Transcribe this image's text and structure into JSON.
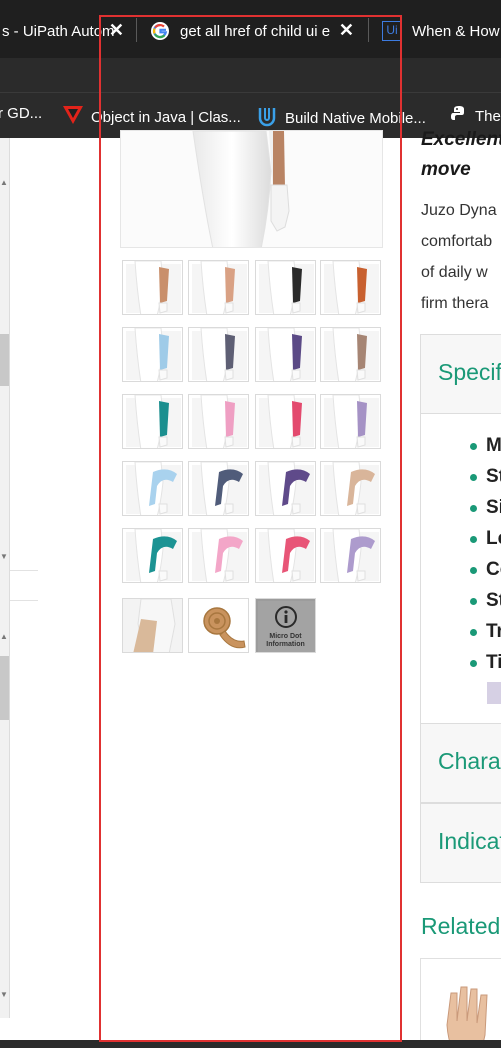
{
  "browser": {
    "tabs": [
      {
        "title": "s - UiPath Autom",
        "close": "✕"
      },
      {
        "title": "get all href of child ui e",
        "close": "✕"
      },
      {
        "title": "When & How",
        "close": ""
      }
    ],
    "bookmarks": [
      {
        "label": "r GD..."
      },
      {
        "label": "Object in Java | Clas..."
      },
      {
        "label": "Build Native Mobile..."
      },
      {
        "label": "The"
      }
    ]
  },
  "gallery": {
    "thumbnail_colors": [
      [
        "#c98f6b",
        "#d9a184",
        "#2b2b2b",
        "#c8602f"
      ],
      [
        "#9fcbe8",
        "#5e5f74",
        "#5b4a86",
        "#a68574"
      ],
      [
        "#1b8f8f",
        "#ef9fc3",
        "#e34a6e",
        "#a592c5"
      ],
      [
        "#a9d2ee",
        "#505c7a",
        "#5f4a8a",
        "#d9b59a"
      ],
      [
        "#1c9393",
        "#f3a6c8",
        "#e85577",
        "#ad9bcd"
      ]
    ],
    "last_row": {
      "skin_icon": "skin-sleeve-photo",
      "bandage_icon": "rolled-bandage-photo",
      "info_icon": "info-icon",
      "info_label_line1": "Micro Dot",
      "info_label_line2": "Information"
    }
  },
  "product": {
    "tagline_line1": "Excellent",
    "tagline_line2": "move",
    "desc_lines": [
      "Juzo Dyna",
      "comfortab",
      "of daily w",
      "firm thera"
    ],
    "spec_title": "Specif",
    "spec_items": [
      "M",
      "St",
      "Si",
      "Le",
      "Co",
      "St",
      "Tr",
      "Ti"
    ],
    "characteristics_title": "Charac",
    "indications_title": "Indicat",
    "related_title": "Related"
  },
  "colors": {
    "accent": "#1a9977",
    "annotation": "#e03131"
  }
}
